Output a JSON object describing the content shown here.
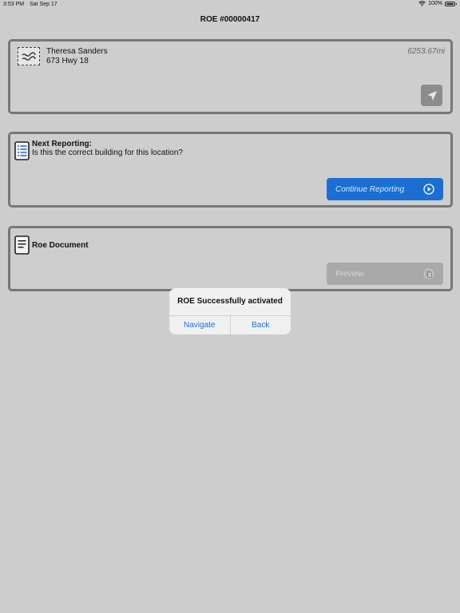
{
  "status_bar": {
    "time": "3:53 PM",
    "date": "Sat Sep 17",
    "battery": "100%",
    "battery_level": 1.0
  },
  "header": {
    "title": "ROE #00000417"
  },
  "customer_card": {
    "name": "Theresa Sanders",
    "address": "673 Hwy 18",
    "distance": "6253.67mi",
    "icon": "stamp-icon",
    "nav_icon": "location-arrow-icon"
  },
  "reporting_card": {
    "title": "Next Reporting:",
    "question": "Is this the correct building for this location?",
    "button_label": "Continue Reporting",
    "icon": "list-document-icon",
    "button_icon": "play-circle-icon"
  },
  "document_card": {
    "title": "Roe Document",
    "button_label": "Preview",
    "icon": "document-icon",
    "button_icon": "pages-icon"
  },
  "alert": {
    "title": "ROE Successfully activated",
    "navigate_label": "Navigate",
    "back_label": "Back"
  },
  "colors": {
    "background": "#cdcdcd",
    "card_border": "#777777",
    "primary_button": "#1a6fd1",
    "disabled_button": "#a9a9a9",
    "alert_link": "#1a73d9"
  }
}
